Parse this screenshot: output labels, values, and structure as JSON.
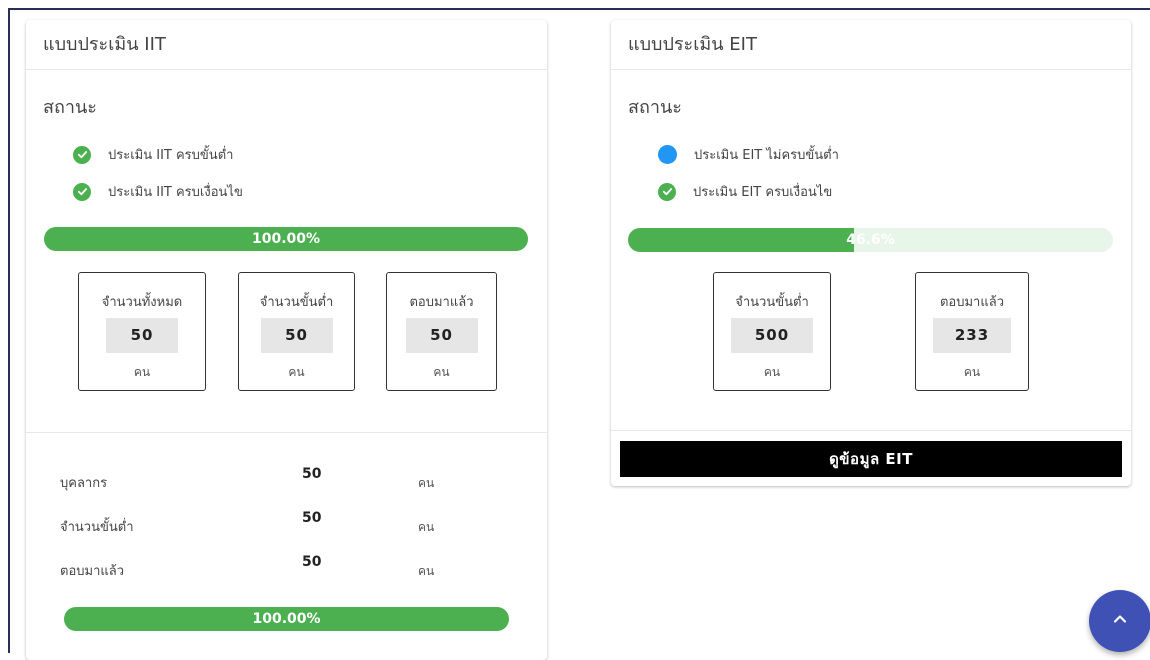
{
  "iit": {
    "title": "แบบประเมิน IIT",
    "status_title": "สถานะ",
    "status": [
      {
        "text": "ประเมิน IIT ครบขั้นต่ำ",
        "state": "complete"
      },
      {
        "text": "ประเมิน IIT ครบเงื่อนไข",
        "state": "complete"
      }
    ],
    "progress": {
      "label": "100.00%",
      "value": 100
    },
    "stats": [
      {
        "label": "จำนวนทั้งหมด",
        "value": "50",
        "unit": "คน"
      },
      {
        "label": "จำนวนขั้นต่ำ",
        "value": "50",
        "unit": "คน"
      },
      {
        "label": "ตอบมาแล้ว",
        "value": "50",
        "unit": "คน"
      }
    ],
    "summary": [
      {
        "label": "บุคลากร",
        "value": "50",
        "unit": "คน"
      },
      {
        "label": "จำนวนขั้นต่ำ",
        "value": "50",
        "unit": "คน"
      },
      {
        "label": "ตอบมาแล้ว",
        "value": "50",
        "unit": "คน"
      }
    ],
    "summary_progress": {
      "label": "100.00%",
      "value": 100
    }
  },
  "eit": {
    "title": "แบบประเมิน EIT",
    "status_title": "สถานะ",
    "status": [
      {
        "text": "ประเมิน EIT ไม่ครบขั้นต่ำ",
        "state": "incomplete"
      },
      {
        "text": "ประเมิน EIT ครบเงื่อนไข",
        "state": "complete"
      }
    ],
    "progress": {
      "label": "46.6%",
      "value": 46.6
    },
    "stats": [
      {
        "label": "จำนวนขั้นต่ำ",
        "value": "500",
        "unit": "คน"
      },
      {
        "label": "ตอบมาแล้ว",
        "value": "233",
        "unit": "คน"
      }
    ],
    "button_label": "ดูข้อมูล EIT"
  },
  "colors": {
    "success": "#4caf50",
    "incomplete": "#2196f3",
    "track": "#e8f5e9",
    "fab": "#3f51b5"
  },
  "icons": {
    "status_complete": "check-circle-icon",
    "status_incomplete": "circle-icon",
    "fab": "chevron-up-icon"
  }
}
